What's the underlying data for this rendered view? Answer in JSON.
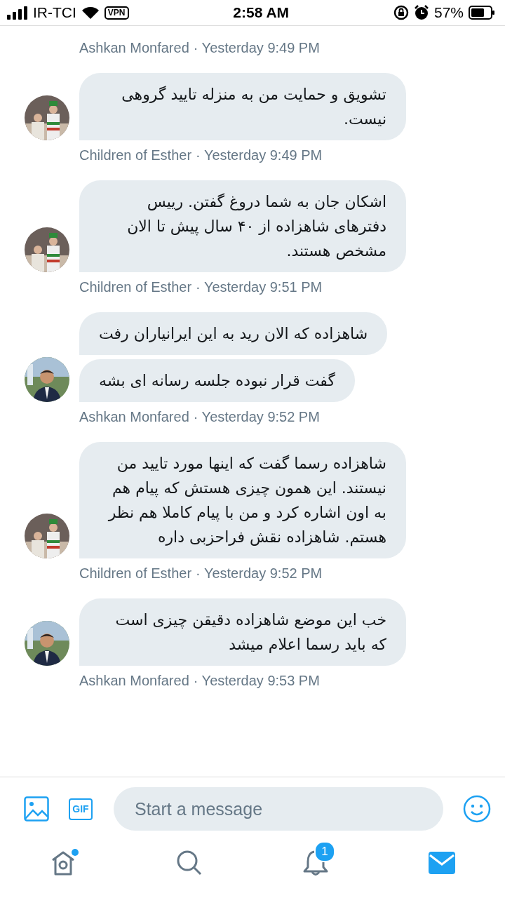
{
  "status_bar": {
    "carrier": "IR-TCI",
    "vpn": "VPN",
    "time": "2:58 AM",
    "battery_percent": "57%"
  },
  "conversation": [
    {
      "sender": "Ashkan Monfared",
      "time": "· Yesterday 9:49 PM"
    },
    {
      "avatar": {
        "kind": "picture"
      },
      "bubbles": [
        "تشویق و حمایت من به منزله تایید گروهی نیست."
      ],
      "sender": "Children of Esther",
      "time": "· Yesterday 9:49 PM"
    },
    {
      "avatar": {
        "kind": "picture"
      },
      "bubbles": [
        "اشکان جان به شما دروغ گفتن. رییس دفترهای  شاهزاده از ۴۰ سال پیش تا الان مشخص هستند."
      ],
      "sender": "Children of Esther",
      "time": "· Yesterday 9:51 PM"
    },
    {
      "avatar": {
        "kind": "picture"
      },
      "bubbles": [
        "شاهزاده که الان رید به این ایرانیاران رفت",
        "گفت قرار نبوده جلسه رسانه ای بشه"
      ],
      "sender": "Ashkan Monfared",
      "time": "· Yesterday 9:52 PM"
    },
    {
      "avatar": {
        "kind": "picture"
      },
      "bubbles": [
        "شاهزاده رسما گفت که اینها مورد تایید من نیستند. این همون چیزی هستش که پیام هم به اون اشاره کرد و من با پیام کاملا هم نظر هستم. شاهزاده نقش فراحزبی داره"
      ],
      "sender": "Children of Esther",
      "time": "· Yesterday 9:52 PM"
    },
    {
      "avatar": {
        "kind": "picture"
      },
      "bubbles": [
        "خب این موضع شاهزاده دقیقن چیزی است که باید رسما اعلام میشد"
      ],
      "sender": "Ashkan Monfared",
      "time": "· Yesterday 9:53 PM"
    }
  ],
  "composer": {
    "gif_label": "GIF",
    "placeholder": "Start a message"
  },
  "tab_bar": [
    {
      "kind": "home",
      "selected": false,
      "unread_dot": true
    },
    {
      "kind": "search",
      "selected": false
    },
    {
      "kind": "notifications",
      "selected": false,
      "badge": "1"
    },
    {
      "kind": "messages",
      "selected": true
    }
  ]
}
